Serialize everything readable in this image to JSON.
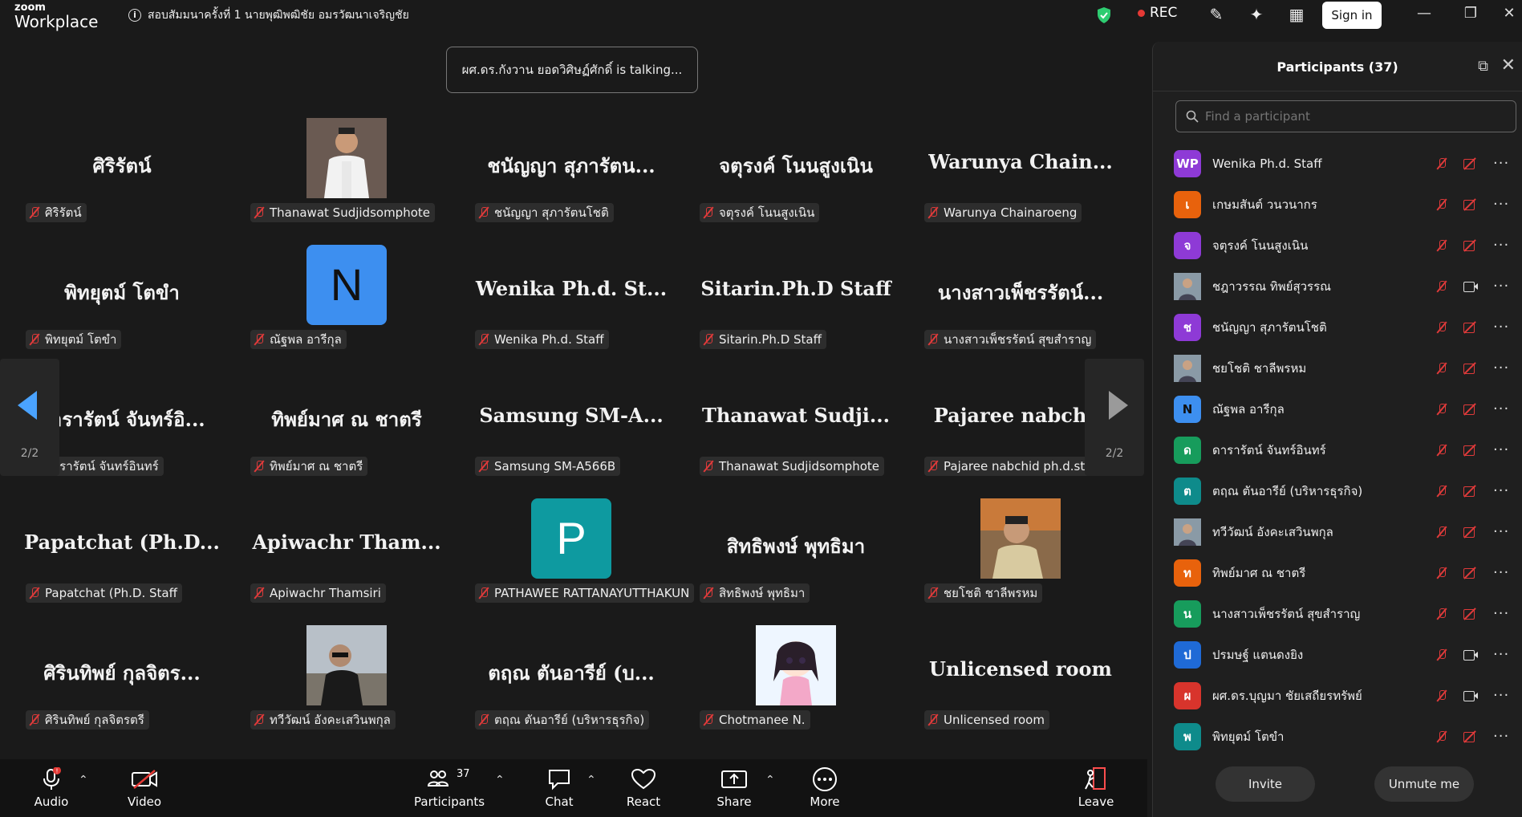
{
  "app": {
    "brand_small": "zoom",
    "brand_large": "Workplace"
  },
  "meeting": {
    "title": "สอบสัมมนาครั้งที่ 1   นายพุฒิพฒิชัย อมรวัฒนาเจริญชัย"
  },
  "titlebar": {
    "rec_label": "REC",
    "signin_label": "Sign in"
  },
  "talking": {
    "text": "ผศ.ดร.กังวาน ยอดวิศิษฏ์ศักดิ์ is talking..."
  },
  "pager": {
    "left": "2/2",
    "right": "2/2"
  },
  "grid": [
    {
      "big": "ศิริรัตน์",
      "tag": "ศิริรัตน์",
      "avatar": "none"
    },
    {
      "big": "",
      "tag": "Thanawat Sudjidsomphote",
      "avatar": "photo-uniform"
    },
    {
      "big": "ชนัญญา สุภารัตน...",
      "tag": "ชนัญญา สุภารัตนโชติ",
      "avatar": "none"
    },
    {
      "big": "จตุรงค์ โนนสูงเนิน",
      "tag": "จตุรงค์ โนนสูงเนิน",
      "avatar": "none"
    },
    {
      "big": "Warunya  Chain...",
      "tag": "Warunya Chainaroeng",
      "avatar": "none"
    },
    {
      "big": "พิทยุตม์ โตขำ",
      "tag": "พิทยุตม์ โตขำ",
      "avatar": "none"
    },
    {
      "big": "",
      "tag": "ณัฐพล อารีกุล",
      "avatar": "letter",
      "letter": "N"
    },
    {
      "big": "Wenika Ph.d. St...",
      "tag": "Wenika Ph.d. Staff",
      "avatar": "none"
    },
    {
      "big": "Sitarin.Ph.D Staff",
      "tag": "Sitarin.Ph.D Staff",
      "avatar": "none"
    },
    {
      "big": "นางสาวเพ็ชรรัตน์...",
      "tag": "นางสาวเพ็ชรรัตน์ สุขสำราญ",
      "avatar": "none"
    },
    {
      "big": "ดารารัตน์ จันทร์อิ...",
      "tag": "ดารารัตน์ จันทร์อินทร์",
      "avatar": "none"
    },
    {
      "big": "ทิพย์มาศ ณ ชาตรี",
      "tag": "ทิพย์มาศ ณ ชาตรี",
      "avatar": "none"
    },
    {
      "big": "Samsung  SM-A...",
      "tag": "Samsung SM-A566B",
      "avatar": "none"
    },
    {
      "big": "Thanawat  Sudji...",
      "tag": "Thanawat Sudjidsomphote",
      "avatar": "none"
    },
    {
      "big": "Pajaree  nabchid",
      "tag": "Pajaree nabchid ph.d.stuff",
      "avatar": "none"
    },
    {
      "big": "Papatchat  (Ph.D...",
      "tag": "Papatchat (Ph.D. Staff",
      "avatar": "none"
    },
    {
      "big": "Apiwachr  Tham...",
      "tag": "Apiwachr Thamsiri",
      "avatar": "none"
    },
    {
      "big": "",
      "tag": "PATHAWEE RATTANAYUTTHAKUN",
      "avatar": "letter",
      "letter": "P"
    },
    {
      "big": "สิทธิพงษ์ พุทธิมา",
      "tag": "สิทธิพงษ์ พุทธิมา",
      "avatar": "none"
    },
    {
      "big": "",
      "tag": "ชยโชติ ชาลีพรหม",
      "avatar": "photo-man"
    },
    {
      "big": "ศิรินทิพย์  กุลจิตร...",
      "tag": "ศิรินทิพย์  กุลจิตรตรี",
      "avatar": "none"
    },
    {
      "big": "",
      "tag": "ทวีวัฒน์ อังคะเสวินพกุล",
      "avatar": "photo-sunglasses"
    },
    {
      "big": "ตฤณ ตันอารีย์ (บ...",
      "tag": "ตฤณ ตันอารีย์ (บริหารธุรกิจ)",
      "avatar": "none"
    },
    {
      "big": "",
      "tag": "Chotmanee N.",
      "avatar": "photo-cartoon"
    },
    {
      "big": "Unlicensed room",
      "tag": "Unlicensed room",
      "avatar": "none"
    }
  ],
  "toolbar": {
    "audio": "Audio",
    "video": "Video",
    "participants": "Participants",
    "participants_count": "37",
    "chat": "Chat",
    "react": "React",
    "share": "Share",
    "more": "More",
    "leave": "Leave",
    "audio_badge": "!"
  },
  "panel": {
    "title": "Participants (37)",
    "search_placeholder": "Find a participant",
    "invite": "Invite",
    "unmute": "Unmute me",
    "participants": [
      {
        "initials": "WP",
        "name": "Wenika Ph.d. Staff",
        "color": "#8e3ad6",
        "video": "off"
      },
      {
        "initials": "เ",
        "name": "เกษมสันต์ วนวนากร",
        "color": "#e8620c",
        "video": "off"
      },
      {
        "initials": "จ",
        "name": "จตุรงค์ โนนสูงเนิน",
        "color": "#8e3ad6",
        "video": "off"
      },
      {
        "initials": "",
        "name": "ชฎาวรรณ ทิพย์สุวรรณ",
        "color": "#7a8a9a",
        "video": "on",
        "photo": true
      },
      {
        "initials": "ช",
        "name": "ชนัญญา สุภารัตนโชติ",
        "color": "#8e3ad6",
        "video": "off"
      },
      {
        "initials": "",
        "name": "ชยโชติ ชาลีพรหม",
        "color": "#a08060",
        "video": "off",
        "photo": true
      },
      {
        "initials": "N",
        "name": "ณัฐพล อารีกุล",
        "color": "#3d8ff0",
        "video": "off",
        "letter_dark": true
      },
      {
        "initials": "ด",
        "name": "ดารารัตน์ จันทร์อินทร์",
        "color": "#179c5c",
        "video": "off"
      },
      {
        "initials": "ต",
        "name": "ตฤณ ตันอารีย์ (บริหารธุรกิจ)",
        "color": "#0e8b8b",
        "video": "off"
      },
      {
        "initials": "",
        "name": "ทวีวัฒน์ อังคะเสวินพกุล",
        "color": "#6b6b6b",
        "video": "off",
        "photo": true
      },
      {
        "initials": "ท",
        "name": "ทิพย์มาศ ณ ชาตรี",
        "color": "#e8620c",
        "video": "off"
      },
      {
        "initials": "น",
        "name": "นางสาวเพ็ชรรัตน์ สุขสำราญ",
        "color": "#179c5c",
        "video": "off"
      },
      {
        "initials": "ป",
        "name": "ปรมษฐ์ แตนดงยิง",
        "color": "#1f6ad6",
        "video": "on"
      },
      {
        "initials": "ผ",
        "name": "ผศ.ดร.บุญมา ชัยเสถียรทรัพย์",
        "color": "#d8342c",
        "video": "on"
      },
      {
        "initials": "พ",
        "name": "พิทยุตม์ โตขำ",
        "color": "#0e8b8b",
        "video": "off"
      }
    ]
  },
  "colors": {
    "accent": "#4aa3ff",
    "muted_red": "#e03a3a",
    "shield_green": "#2ecc71",
    "panel_bg": "#1f1f1f"
  }
}
